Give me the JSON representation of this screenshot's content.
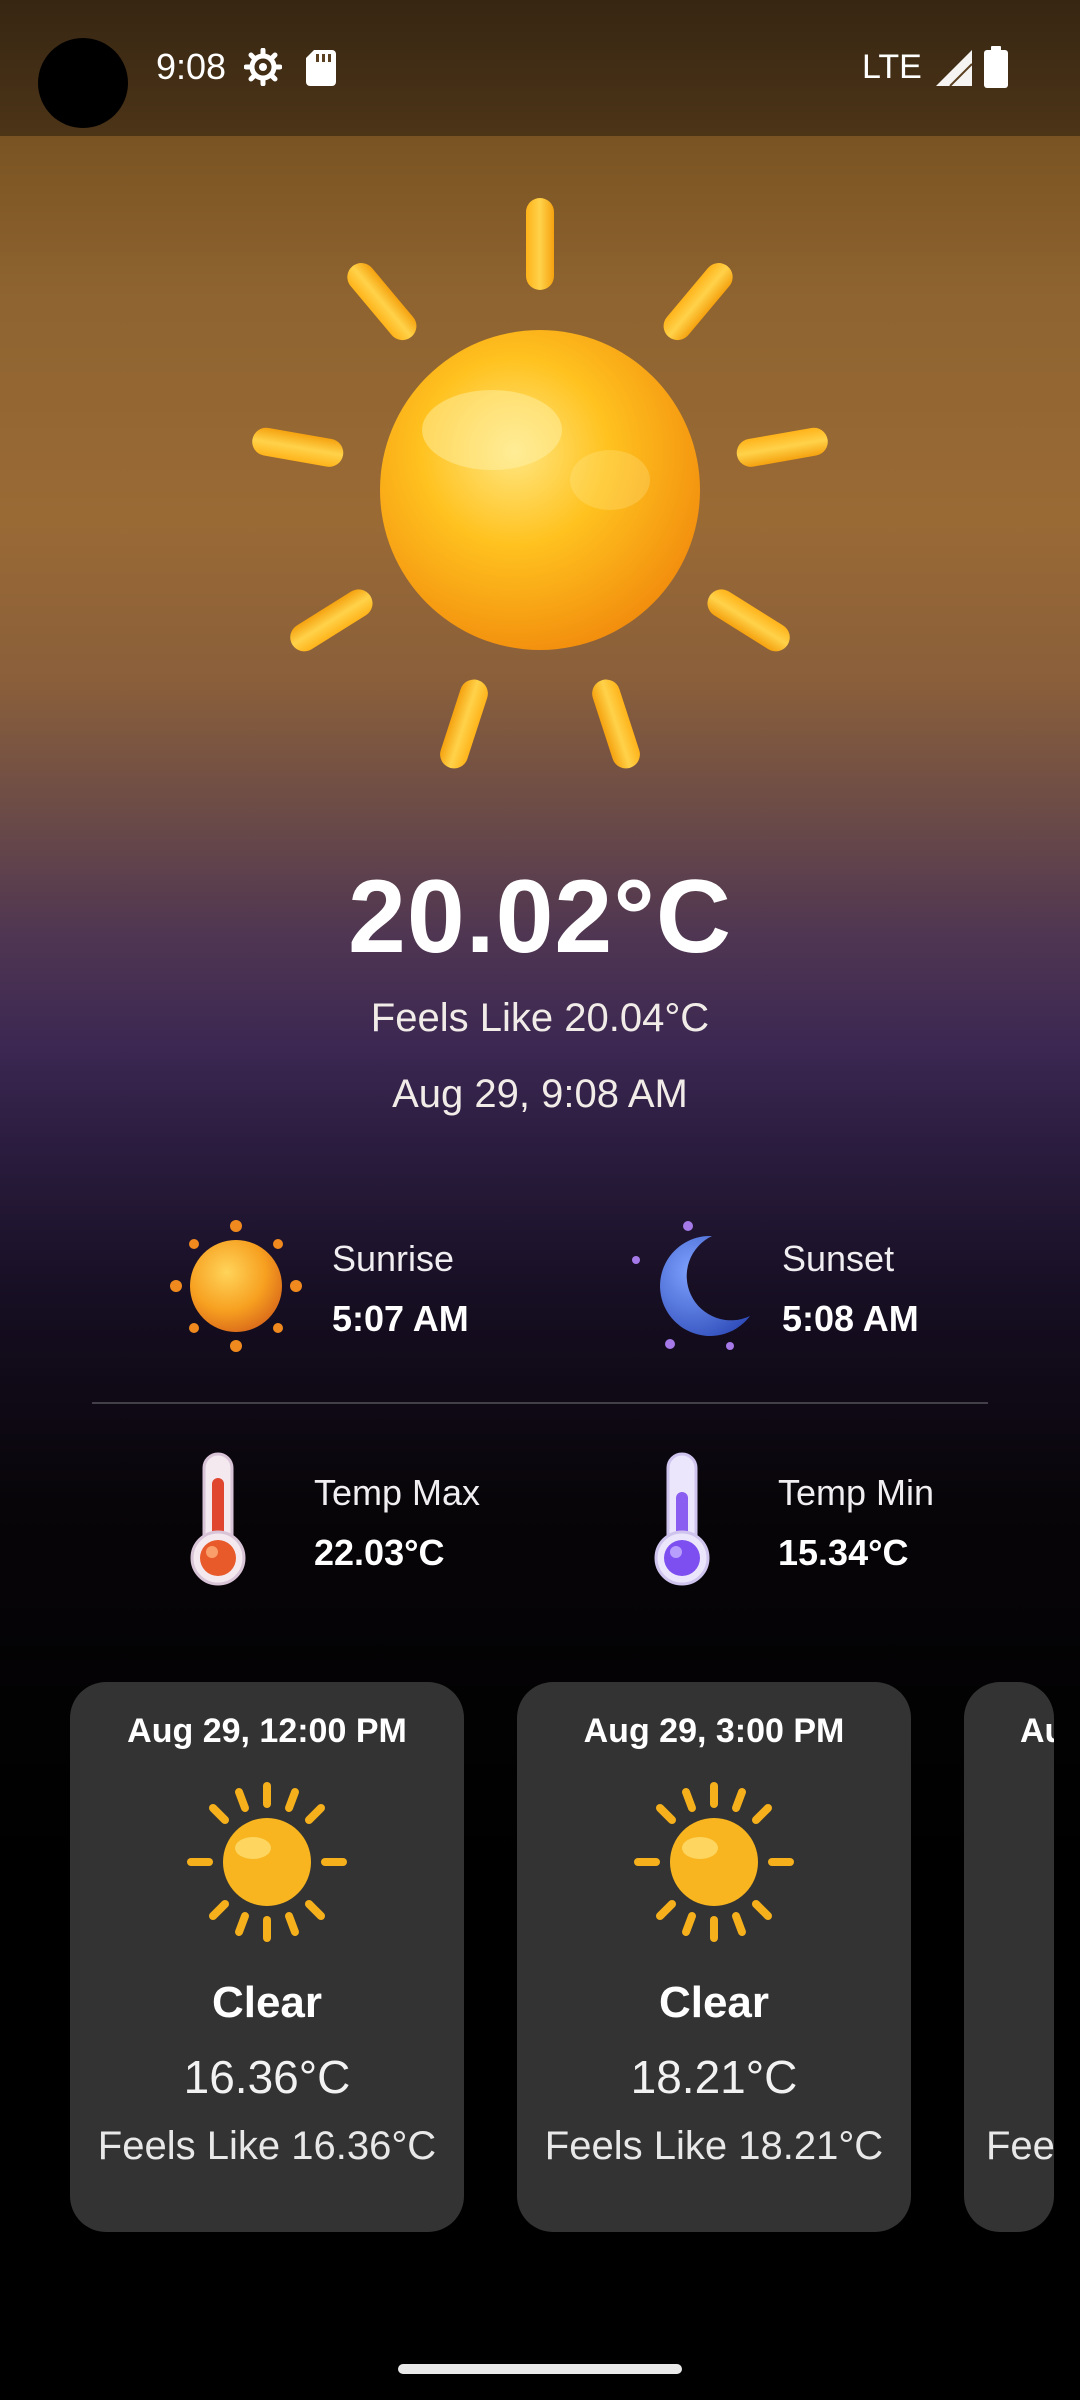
{
  "status_bar": {
    "time": "9:08",
    "network": "LTE",
    "icons": [
      "settings-gear-icon",
      "sd-card-icon",
      "signal-icon",
      "battery-icon"
    ]
  },
  "current": {
    "icon": "sun-3d-icon",
    "temperature": "20.02°C",
    "feels_like": "Feels Like 20.04°C",
    "datetime": "Aug 29, 9:08 AM"
  },
  "sun_times": {
    "sunrise_label": "Sunrise",
    "sunrise_value": "5:07 AM",
    "sunset_label": "Sunset",
    "sunset_value": "5:08 AM"
  },
  "temps": {
    "max_label": "Temp Max",
    "max_value": "22.03°C",
    "min_label": "Temp Min",
    "min_value": "15.34°C"
  },
  "forecast": [
    {
      "date": "Aug 29, 12:00 PM",
      "icon": "sun-icon",
      "condition": "Clear",
      "temp": "16.36°C",
      "feels": "Feels Like 16.36°C"
    },
    {
      "date": "Aug 29, 3:00 PM",
      "icon": "sun-icon",
      "condition": "Clear",
      "temp": "18.21°C",
      "feels": "Feels Like 18.21°C"
    },
    {
      "date": "Au",
      "icon": "",
      "condition": "",
      "temp": "",
      "feels": "Fee"
    }
  ],
  "colors": {
    "card_bg": "#333333",
    "sun": "#f7b21e",
    "moon": "#4a6fd8",
    "thermo_max": "#e0452f",
    "thermo_min": "#8a5ef0"
  }
}
